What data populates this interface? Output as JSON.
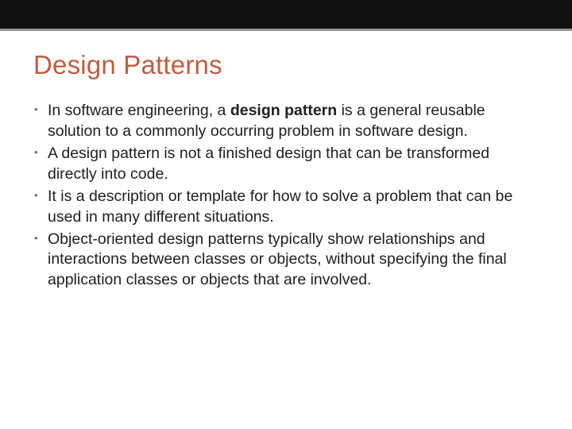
{
  "title": "Design Patterns",
  "bullets": [
    {
      "pre": "In software engineering, a ",
      "bold": "design pattern",
      "post": " is a general reusable solution to a commonly occurring problem in software design."
    },
    {
      "pre": "A design pattern is not a finished design that can be transformed directly into code.",
      "bold": "",
      "post": ""
    },
    {
      "pre": "It is a description or template for how to solve a problem that can be used in many different situations.",
      "bold": "",
      "post": ""
    },
    {
      "pre": "Object-oriented design patterns typically show relationships and interactions between classes or objects, without specifying the final application classes or objects that are involved.",
      "bold": "",
      "post": ""
    }
  ]
}
